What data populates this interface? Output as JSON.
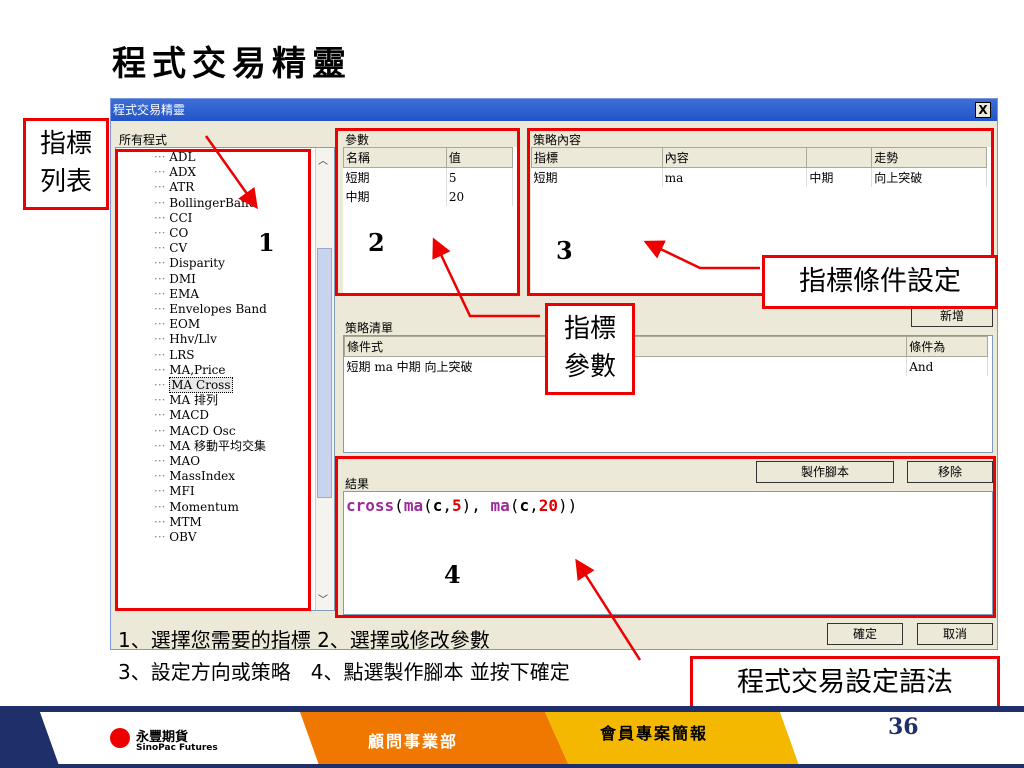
{
  "slide": {
    "title": "程式交易精靈",
    "page_number": "36"
  },
  "dialog": {
    "title": "程式交易精靈",
    "close": "X",
    "formula_list": {
      "header": "所有程式",
      "items": [
        "ADL",
        "ADX",
        "ATR",
        "BollingerBand",
        "CCI",
        "CO",
        "CV",
        "Disparity",
        "DMI",
        "EMA",
        "Envelopes Band",
        "EOM",
        "Hhv/Llv",
        "LRS",
        "MA,Price",
        "MA Cross",
        "MA 排列",
        "MACD",
        "MACD Osc",
        "MA 移動平均交集",
        "MAO",
        "MassIndex",
        "MFI",
        "Momentum",
        "MTM",
        "OBV"
      ],
      "selected": "MA Cross"
    },
    "params": {
      "header": "參數",
      "columns": [
        "名稱",
        "值"
      ],
      "rows": [
        [
          "短期",
          "5"
        ],
        [
          "中期",
          "20"
        ]
      ]
    },
    "strategy_content": {
      "header": "策略內容",
      "columns": [
        "指標",
        "內容",
        "",
        "走勢"
      ],
      "rows": [
        [
          "短期",
          "ma",
          "中期",
          "向上突破"
        ]
      ]
    },
    "strategy_list": {
      "header": "策略清單",
      "add_button": "新增",
      "columns": [
        "條件式",
        "條件為"
      ],
      "rows": [
        [
          "短期 ma 中期 向上突破",
          "And"
        ]
      ]
    },
    "result": {
      "header": "結果",
      "make_script_button": "製作腳本",
      "remove_button": "移除",
      "code": {
        "func": "cross",
        "open": "(",
        "ma1": "ma",
        "p1": "(",
        "c1": "c",
        "comma1": ",",
        "n1": "5",
        "close1": ")",
        "sep": ", ",
        "ma2": "ma",
        "p2": "(",
        "c2": "c",
        "comma2": ",",
        "n2": "20",
        "close2": ")",
        "close": ")"
      }
    },
    "ok_button": "確定",
    "cancel_button": "取消"
  },
  "annotations": {
    "indicator_list": "指標\n列表",
    "num1": "1",
    "num2": "2",
    "num3": "3",
    "num4": "4",
    "indicator_params": "指標\n參數",
    "indicator_condition": "指標條件設定",
    "syntax": "程式交易設定語法",
    "step_line1": "1、選擇您需要的指標 2、選擇或修改參數",
    "step_line2": "3、設定方向或策略　4、點選製作腳本 並按下確定"
  },
  "footer": {
    "logo_cn": "永豐期貨",
    "logo_en": "SinoPac Futures",
    "dept": "顧問事業部",
    "report": "會員專案簡報"
  },
  "colors": {
    "red": "#e00000",
    "orange": "#f07800",
    "navy": "#1f2f6a",
    "code_purple": "#9b2a9b",
    "code_red": "#e00000"
  }
}
